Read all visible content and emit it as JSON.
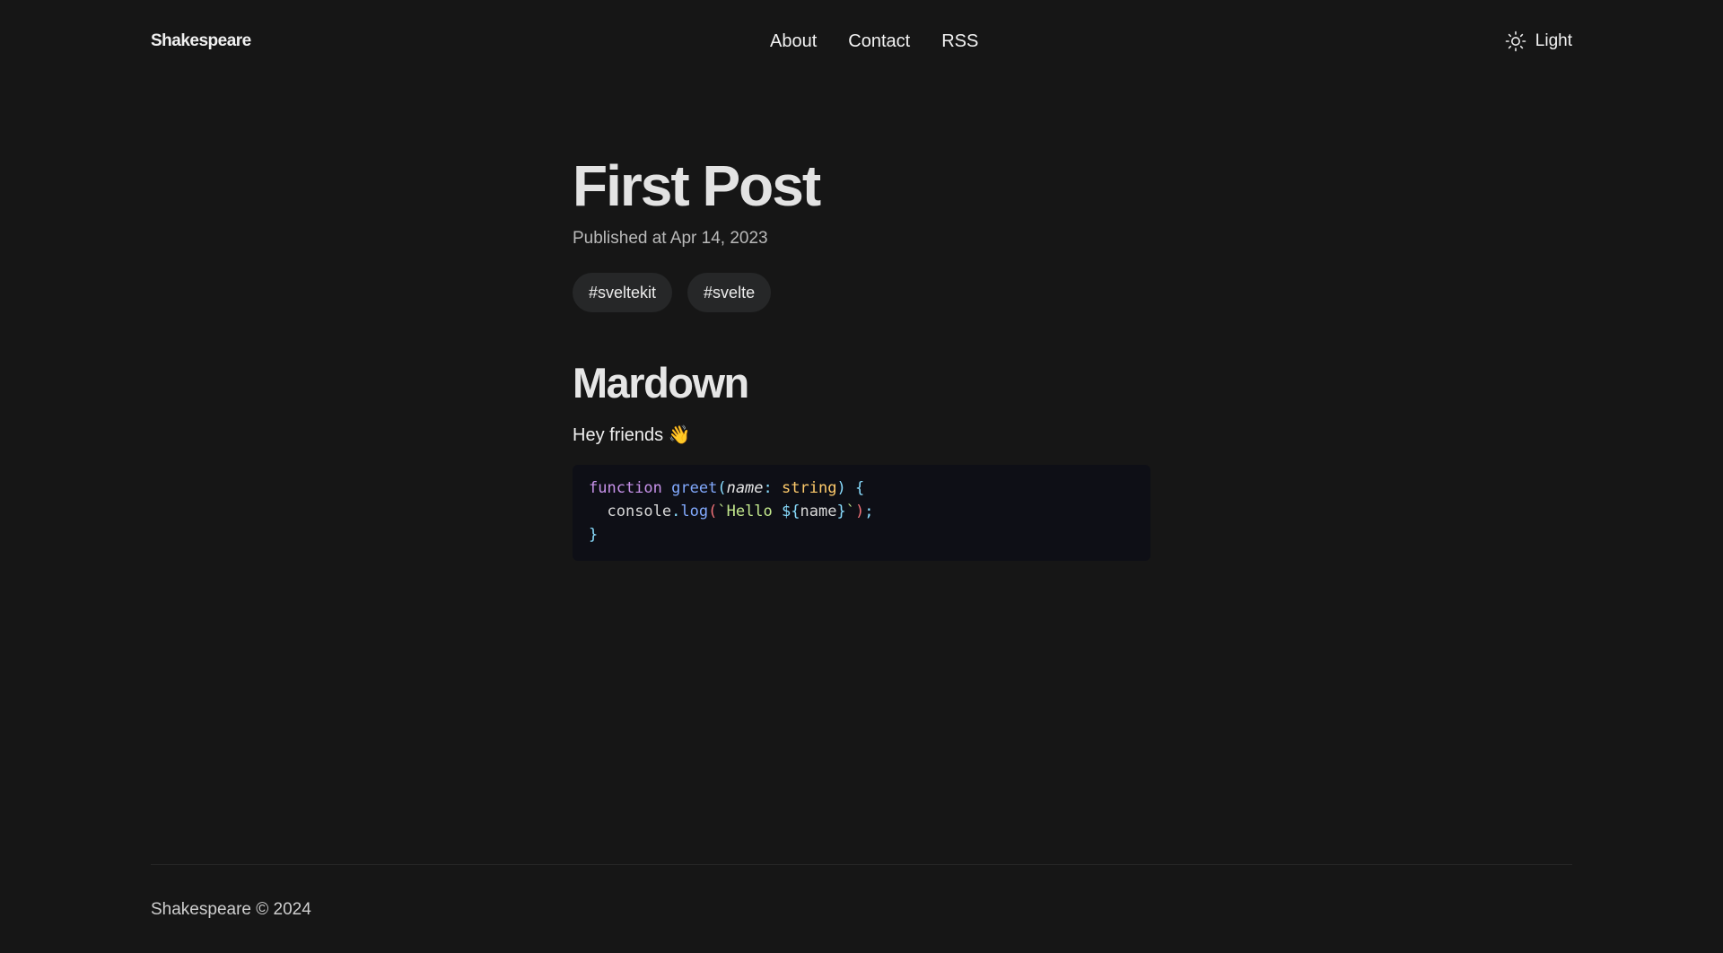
{
  "header": {
    "logo": "Shakespeare",
    "nav": [
      "About",
      "Contact",
      "RSS"
    ],
    "theme_toggle": {
      "label": "Light",
      "icon": "sun-icon"
    }
  },
  "post": {
    "title": "First Post",
    "published": "Published at Apr 14, 2023",
    "tags": [
      "#sveltekit",
      "#svelte"
    ],
    "section_title": "Mardown",
    "paragraph": "Hey friends",
    "paragraph_emoji": "👋",
    "code": {
      "language": "typescript",
      "lines": [
        "function greet(name: string) {",
        "  console.log(`Hello ${name}`);",
        "}"
      ]
    }
  },
  "footer": {
    "text": "Shakespeare © 2024"
  },
  "colors": {
    "background": "#161616",
    "tag_background": "#262728",
    "code_background": "#0e0f16",
    "keyword": "#c792ea",
    "function": "#82aaff",
    "type": "#ffcb6b",
    "string": "#c3e88d"
  }
}
